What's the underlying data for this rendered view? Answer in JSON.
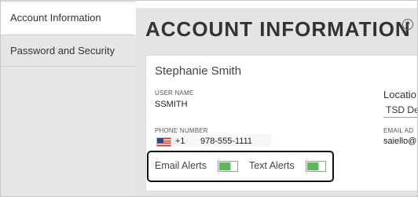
{
  "sidebar": {
    "items": [
      {
        "label": "Account Information",
        "active": true
      },
      {
        "label": "Password and Security",
        "active": false
      }
    ]
  },
  "header": {
    "title": "ACCOUNT INFORMATION",
    "help_glyph": "?"
  },
  "account": {
    "full_name": "Stephanie Smith",
    "username_label": "USER NAME",
    "username": "SSMITH",
    "phone_label": "PHONE NUMBER",
    "phone_country_code": "+1",
    "phone_number": "978-555-1111",
    "location_label": "Locatio",
    "location_value": "TSD De",
    "email_label": "EMAIL AD",
    "email_value": "saiello@"
  },
  "alerts": {
    "email_label": "Email Alerts",
    "email_enabled": true,
    "text_label": "Text Alerts",
    "text_enabled": true
  },
  "colors": {
    "toggle_on": "#5cb85c",
    "sidebar_bg": "#e6e6e6",
    "main_bg": "#e4e4e4"
  }
}
